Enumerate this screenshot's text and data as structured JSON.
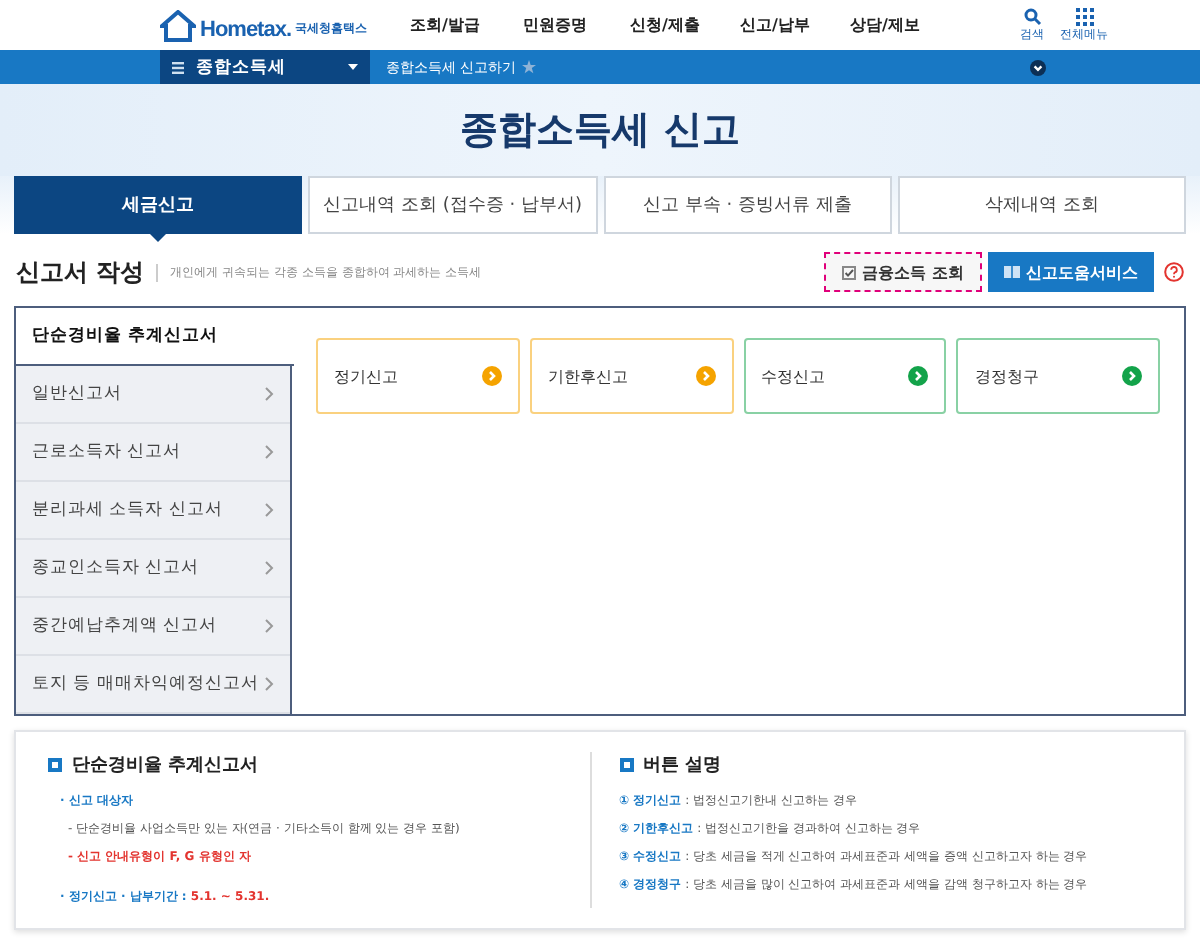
{
  "header": {
    "logo": "Hometax.",
    "logo_suffix": "국세청홈택스",
    "nav": [
      "조회/발급",
      "민원증명",
      "신청/제출",
      "신고/납부",
      "상담/제보"
    ],
    "search": "검색",
    "all_menu": "전체메뉴"
  },
  "breadcrumb": {
    "section": "종합소득세",
    "page": "종합소득세 신고하기"
  },
  "title": "종합소득세 신고",
  "tabs": [
    {
      "label": "세금신고",
      "selected": true
    },
    {
      "label": "신고내역 조회 (접수증 · 납부서)",
      "selected": false
    },
    {
      "label": "신고 부속 · 증빙서류 제출",
      "selected": false
    },
    {
      "label": "삭제내역 조회",
      "selected": false
    }
  ],
  "section": {
    "title": "신고서 작성",
    "desc": "개인에게 귀속되는 각종 소득을 종합하여 과세하는 소득세",
    "buttons": [
      {
        "label": "금융소득 조회",
        "kind": "outline"
      },
      {
        "label": "신고도움서비스",
        "kind": "primary"
      }
    ]
  },
  "forms": [
    {
      "label": "단순경비율 추계신고서",
      "selected": true
    },
    {
      "label": "일반신고서",
      "selected": false
    },
    {
      "label": "근로소득자 신고서",
      "selected": false
    },
    {
      "label": "분리과세 소득자 신고서",
      "selected": false
    },
    {
      "label": "종교인소득자 신고서",
      "selected": false
    },
    {
      "label": "중간예납추계액 신고서",
      "selected": false
    },
    {
      "label": "토지 등 매매차익예정신고서",
      "selected": false
    }
  ],
  "actions": [
    {
      "label": "정기신고",
      "color": "#f5a300"
    },
    {
      "label": "기한후신고",
      "color": "#f5a300"
    },
    {
      "label": "수정신고",
      "color": "#13a34a"
    },
    {
      "label": "경정청구",
      "color": "#13a34a"
    }
  ],
  "info": {
    "title": "단순경비율 추계신고서",
    "lines": [
      {
        "kind": "heading",
        "text": "· 신고 대상자"
      },
      {
        "kind": "note",
        "text": "- 단순경비율 사업소득만 있는 자(연금 · 기타소득이 함께 있는 경우 포함)"
      },
      {
        "kind": "warning",
        "text": "- 신고 안내유형이 F, G 유형인 자"
      },
      {
        "kind": "period",
        "text": "· 정기신고 · 납부기간 :",
        "value": "5.1. ~ 5.31."
      }
    ]
  },
  "help": {
    "title": "버튼 설명",
    "items": [
      {
        "num": "①",
        "term": "정기신고",
        "desc": ": 법정신고기한내 신고하는 경우"
      },
      {
        "num": "②",
        "term": "기한후신고",
        "desc": ": 법정신고기한을 경과하여 신고하는 경우"
      },
      {
        "num": "③",
        "term": "수정신고",
        "desc": ": 당초 세금을 적게 신고하여 과세표준과 세액을 증액 신고하고자 하는 경우"
      },
      {
        "num": "④",
        "term": "경정청구",
        "desc": ": 당초 세금을 많이 신고하여 과세표준과 세액을 감액 청구하고자 하는 경우"
      }
    ]
  }
}
